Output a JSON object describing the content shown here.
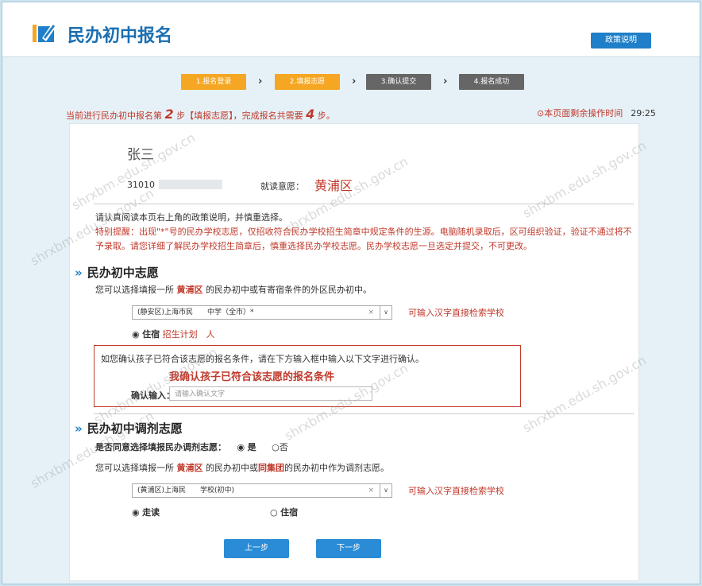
{
  "header": {
    "title": "民办初中报名",
    "policy_button": "政策说明"
  },
  "steps": [
    {
      "label": "1.报名登录",
      "state": "active"
    },
    {
      "label": "2.填报志愿",
      "state": "active"
    },
    {
      "label": "3.确认提交",
      "state": "inactive"
    },
    {
      "label": "4.报名成功",
      "state": "inactive"
    }
  ],
  "status": {
    "prefix": "当前进行民办初中报名第",
    "step": "2",
    "middle": "步【填报志愿】，完成报名共需要",
    "total": "4",
    "suffix": "步。",
    "timer_label": "本页面剩余操作时间",
    "timer_value": "29:25"
  },
  "student": {
    "name": "张三",
    "id_prefix": "31010",
    "intent_label": "就读意愿：",
    "intent_value": "黄浦区"
  },
  "notes": {
    "line1": "请认真阅读本页右上角的政策说明，并慎重选择。",
    "line2": "特别提醒：出现\"*\"号的民办学校志愿，仅招收符合民办学校招生简章中规定条件的生源。电脑随机录取后，区可组织验证，验证不通过将不予录取。请您详细了解民办学校招生简章后，慎重选择民办学校志愿。民办学校志愿一旦选定并提交，不可更改。"
  },
  "section1": {
    "title": "民办初中志愿",
    "desc_a": "您可以选择填报一所",
    "desc_district": "黄浦区",
    "desc_b": "的民办初中或有寄宿条件的外区民办初中。",
    "select_value": "(静安区)上海市民　　中学（全市）*",
    "hint": "可输入汉字直接检索学校",
    "boarding": "住宿",
    "plan": "招生计划　人",
    "confirm_instr": "如您确认孩子已符合该志愿的报名条件，请在下方输入框中输入以下文字进行确认。",
    "confirm_text": "我确认孩子已符合该志愿的报名条件",
    "confirm_label": "确认输入：",
    "confirm_placeholder": "请输入确认文字"
  },
  "section2": {
    "title": "民办初中调剂志愿",
    "agree_label": "是否同意选择填报民办调剂志愿：",
    "yes": "是",
    "no": "否",
    "desc_a": "您可以选择填报一所",
    "desc_district": "黄浦区",
    "desc_b": "的民办初中或",
    "desc_group": "同集团",
    "desc_c": "的民办初中作为调剂志愿。",
    "select_value": "(黄浦区)上海民　　学校(初中)",
    "hint": "可输入汉字直接检索学校",
    "day": "走读",
    "boarding": "住宿"
  },
  "buttons": {
    "prev": "上一步",
    "next": "下一步"
  },
  "watermark": "shrxbm.edu.sh.gov.cn"
}
